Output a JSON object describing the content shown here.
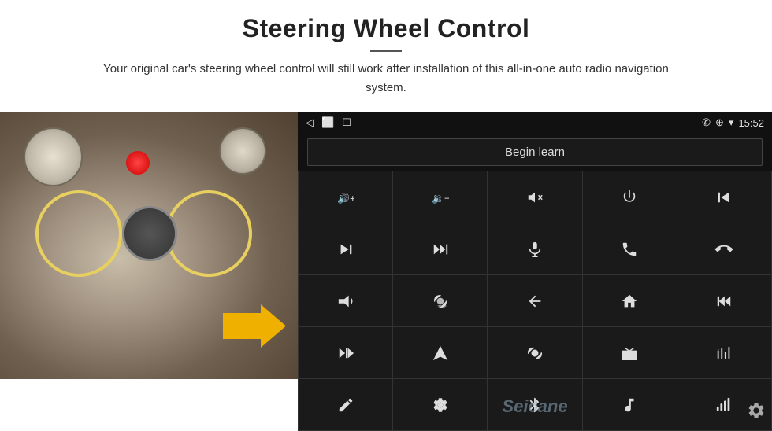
{
  "header": {
    "title": "Steering Wheel Control",
    "subtitle": "Your original car's steering wheel control will still work after installation of this all-in-one auto radio navigation system."
  },
  "screen": {
    "status_bar": {
      "back_icon": "◁",
      "home_icon": "⬜",
      "square_icon": "☐",
      "signal_icon": "▮▮",
      "phone_icon": "✆",
      "location_icon": "⊕",
      "wifi_icon": "▾",
      "time": "15:52"
    },
    "begin_learn_label": "Begin learn",
    "watermark": "Seicane",
    "controls": [
      {
        "icon": "vol_up",
        "unicode": "🔊+"
      },
      {
        "icon": "vol_down",
        "unicode": "🔉−"
      },
      {
        "icon": "mute",
        "unicode": "🔇"
      },
      {
        "icon": "power",
        "unicode": "⏻"
      },
      {
        "icon": "prev_track",
        "unicode": "⏮"
      },
      {
        "icon": "next",
        "unicode": "⏭"
      },
      {
        "icon": "ff_prev",
        "unicode": "⏩◀"
      },
      {
        "icon": "mic",
        "unicode": "🎤"
      },
      {
        "icon": "phone",
        "unicode": "📞"
      },
      {
        "icon": "hang_up",
        "unicode": "📵"
      },
      {
        "icon": "horn",
        "unicode": "📣"
      },
      {
        "icon": "360",
        "unicode": "⟳"
      },
      {
        "icon": "back",
        "unicode": "↩"
      },
      {
        "icon": "home",
        "unicode": "⌂"
      },
      {
        "icon": "rewind",
        "unicode": "⏮⏮"
      },
      {
        "icon": "skip_fwd",
        "unicode": "⏭"
      },
      {
        "icon": "navigate",
        "unicode": "▲"
      },
      {
        "icon": "switch",
        "unicode": "⇄"
      },
      {
        "icon": "radio",
        "unicode": "📻"
      },
      {
        "icon": "eq",
        "unicode": "🎚"
      },
      {
        "icon": "pen",
        "unicode": "✏"
      },
      {
        "icon": "settings2",
        "unicode": "⚙"
      },
      {
        "icon": "bluetooth",
        "unicode": "⚡"
      },
      {
        "icon": "music",
        "unicode": "🎵"
      },
      {
        "icon": "bars",
        "unicode": "📊"
      }
    ],
    "gear_icon": "⚙"
  }
}
